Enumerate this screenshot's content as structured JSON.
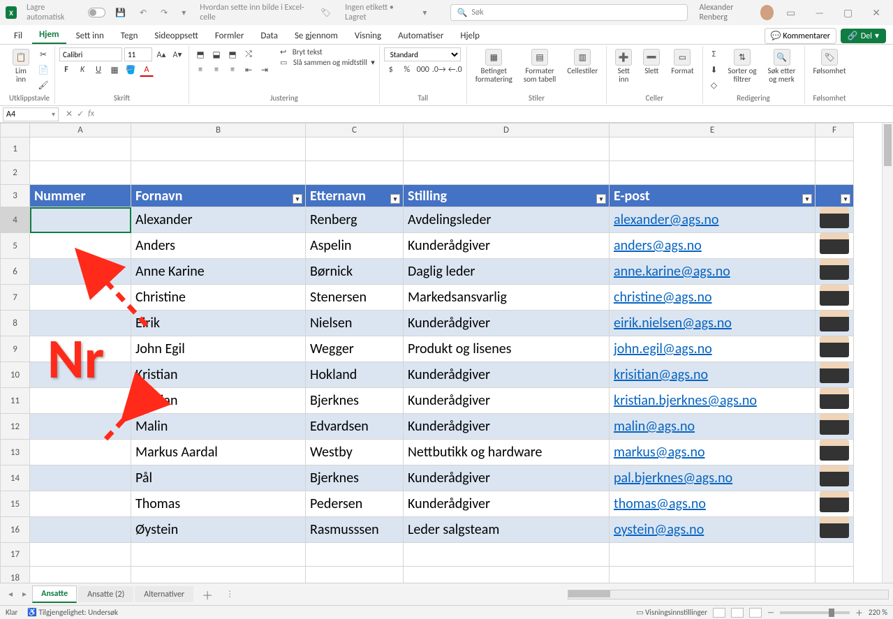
{
  "titlebar": {
    "autosave_label": "Lagre automatisk",
    "doc_title": "Hvordan sette inn bilde i Excel-celle",
    "label_status": "Ingen etikett • Lagret ",
    "search_placeholder": "Søk",
    "user_name": "Alexander Renberg"
  },
  "tabs": {
    "fil": "Fil",
    "hjem": "Hjem",
    "settinn": "Sett inn",
    "tegn": "Tegn",
    "sideoppsett": "Sideoppsett",
    "formler": "Formler",
    "data": "Data",
    "segjennom": "Se gjennom",
    "visning": "Visning",
    "automatiser": "Automatiser",
    "hjelp": "Hjelp",
    "kommentarer": "Kommentarer",
    "del": "Del"
  },
  "ribbon": {
    "clipboard": {
      "paste": "Lim\ninn",
      "label": "Utklippstavle"
    },
    "font": {
      "name": "Calibri",
      "size": "11",
      "label": "Skrift"
    },
    "alignment": {
      "wrap": "Bryt tekst",
      "merge": "Slå sammen og midtstill",
      "label": "Justering"
    },
    "number": {
      "format": "Standard",
      "label": "Tall"
    },
    "styles": {
      "cond": "Betinget\nformatering",
      "table": "Formater\nsom tabell",
      "cell": "Cellestiler",
      "label": "Stiler"
    },
    "cells": {
      "insert": "Sett\ninn",
      "delete": "Slett",
      "format": "Format",
      "label": "Celler"
    },
    "editing": {
      "sort": "Sorter og\nfiltrer",
      "find": "Søk etter\nog merk",
      "label": "Redigering"
    },
    "sensitivity": {
      "btn": "Følsomhet",
      "label": "Følsomhet"
    }
  },
  "cellref": "A4",
  "columns": [
    "A",
    "B",
    "C",
    "D",
    "E",
    "F"
  ],
  "header_row_num": "3",
  "headers": {
    "nummer": "Nummer",
    "fornavn": "Fornavn",
    "etternavn": "Etternavn",
    "stilling": "Stilling",
    "epost": "E-post",
    "foto": ""
  },
  "rows": [
    {
      "n": "4",
      "f": "Alexander",
      "e": "Renberg",
      "s": "Avdelingsleder",
      "m": "alexander@ags.no"
    },
    {
      "n": "5",
      "f": "Anders",
      "e": "Aspelin",
      "s": "Kunderådgiver",
      "m": "anders@ags.no"
    },
    {
      "n": "6",
      "f": "Anne Karine",
      "e": "Børnick",
      "s": "Daglig leder",
      "m": "anne.karine@ags.no"
    },
    {
      "n": "7",
      "f": "Christine",
      "e": "Stenersen",
      "s": "Markedsansvarlig",
      "m": "christine@ags.no"
    },
    {
      "n": "8",
      "f": "Eirik",
      "e": "Nielsen",
      "s": "Kunderådgiver",
      "m": "eirik.nielsen@ags.no"
    },
    {
      "n": "9",
      "f": "John Egil",
      "e": "Wegger",
      "s": "Produkt og lisenes",
      "m": "john.egil@ags.no"
    },
    {
      "n": "10",
      "f": "Kristian",
      "e": "Hokland",
      "s": "Kunderådgiver",
      "m": "krisitian@ags.no"
    },
    {
      "n": "11",
      "f": "Kristian",
      "e": "Bjerknes",
      "s": "Kunderådgiver",
      "m": "kristian.bjerknes@ags.no"
    },
    {
      "n": "12",
      "f": "Malin",
      "e": "Edvardsen",
      "s": "Kunderådgiver",
      "m": "malin@ags.no"
    },
    {
      "n": "13",
      "f": "Markus Aardal",
      "e": "Westby",
      "s": "Nettbutikk og hardware",
      "m": "markus@ags.no"
    },
    {
      "n": "14",
      "f": "Pål",
      "e": "Bjerknes",
      "s": "Kunderådgiver",
      "m": "pal.bjerknes@ags.no"
    },
    {
      "n": "15",
      "f": "Thomas",
      "e": "Pedersen",
      "s": "Kunderådgiver",
      "m": "thomas@ags.no"
    },
    {
      "n": "16",
      "f": "Øystein",
      "e": "Rasmusssen",
      "s": "Leder salgsteam",
      "m": "oystein@ags.no"
    }
  ],
  "empty_rows": [
    "1",
    "2"
  ],
  "trailing_rows": [
    "17",
    "18"
  ],
  "annotation_text": "Nr",
  "sheets": {
    "s1": "Ansatte",
    "s2": "Ansatte (2)",
    "s3": "Alternativer"
  },
  "status": {
    "ready": "Klar",
    "access": "Tilgjengelighet: Undersøk",
    "display": "Visningsinnstillinger",
    "zoom": "220 %"
  }
}
